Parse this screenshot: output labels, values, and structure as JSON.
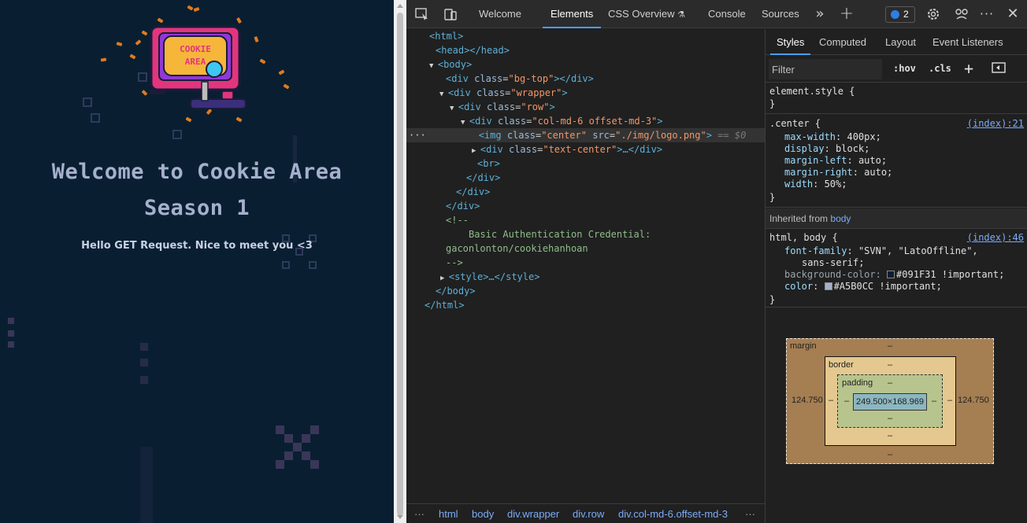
{
  "site": {
    "title_line1": "Welcome to Cookie Area",
    "title_line2": "Season 1",
    "greeting": "Hello GET Request. Nice to meet you <3",
    "logo_text_line1": "COOKIE",
    "logo_text_line2": "AREA",
    "colors": {
      "background": "#091F31",
      "text": "#A5B0CC"
    }
  },
  "devtools": {
    "tabs": [
      "Welcome",
      "Elements",
      "CSS Overview",
      "Console",
      "Sources"
    ],
    "active_tab": "Elements",
    "issues_count": "2",
    "toolbar_icons": [
      "inspect-icon",
      "device-toggle-icon",
      "more-tabs-icon",
      "add-tab-icon",
      "settings-icon",
      "customize-icon",
      "more-options-icon",
      "close-icon"
    ]
  },
  "dom_tree": {
    "l1": "<html>",
    "l2": "<head></head>",
    "l3_tag": "<body>",
    "l4_open": "<div",
    "l4_attr": "class",
    "l4_val": "\"bg-top\"",
    "l4_close": "></div>",
    "l5_open": "<div",
    "l5_attr": "class",
    "l5_val": "\"wrapper\"",
    "l5_close": ">",
    "l6_open": "<div",
    "l6_attr": "class",
    "l6_val": "\"row\"",
    "l6_close": ">",
    "l7_open": "<div",
    "l7_attr": "class",
    "l7_val": "\"col-md-6 offset-md-3\"",
    "l7_close": ">",
    "l8_img": "<img",
    "l8_attr1": "class",
    "l8_val1": "\"center\"",
    "l8_attr2": "src",
    "l8_val2": "\"./img/logo.png\"",
    "l8_close": ">",
    "l8_eq": "== $0",
    "l9_open": "<div",
    "l9_attr": "class",
    "l9_val": "\"text-center\"",
    "l9_close": ">…</div>",
    "l10": "<br>",
    "l11": "</div>",
    "l12": "</div>",
    "l13": "</div>",
    "l14": "<!--",
    "l15": "Basic Authentication Credential:",
    "l16": "gaconlonton/cookiehanhoan",
    "l17": "-->",
    "l18": "<style>…</style>",
    "l19": "</body>",
    "l20": "</html>",
    "ellipsis": "···"
  },
  "breadcrumbs": [
    "html",
    "body",
    "div.wrapper",
    "div.row",
    "div.col-md-6.offset-md-3"
  ],
  "styles_pane": {
    "subtabs": [
      "Styles",
      "Computed",
      "Layout",
      "Event Listeners"
    ],
    "active_subtab": "Styles",
    "filter_placeholder": "Filter",
    "hov": ":hov",
    "cls": ".cls",
    "element_style_selector": "element.style {",
    "brace_close": "}",
    "center_selector": ".center {",
    "center_source": "(index):21",
    "center_props": [
      {
        "name": "max-width",
        "value": "400px;"
      },
      {
        "name": "display",
        "value": "block;"
      },
      {
        "name": "margin-left",
        "value": "auto;"
      },
      {
        "name": "margin-right",
        "value": "auto;"
      },
      {
        "name": "width",
        "value": "50%;"
      }
    ],
    "inherited_label": "Inherited from",
    "inherited_link": "body",
    "htmlbody_selector": "html, body {",
    "htmlbody_source": "(index):46",
    "font_family_name": "font-family",
    "font_family_value": "\"SVN\", \"LatoOffline\",",
    "font_family_cont": "sans-serif;",
    "bg_name": "background-color",
    "bg_value": "#091F31 !important;",
    "bg_color": "#091F31",
    "color_name": "color",
    "color_value": "#A5B0CC !important;",
    "color_color": "#A5B0CC"
  },
  "box_model": {
    "margin_label": "margin",
    "border_label": "border",
    "padding_label": "padding",
    "dash": "–",
    "left_value": "124.750",
    "right_value": "124.750",
    "content_size": "249.500×168.969"
  }
}
